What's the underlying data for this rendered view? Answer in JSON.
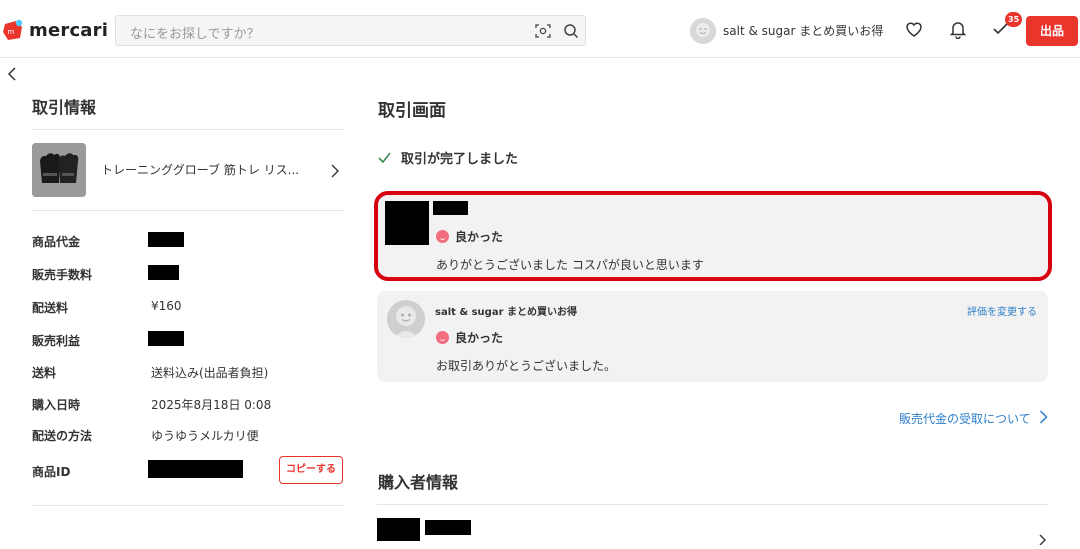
{
  "header": {
    "logo_text": "mercari",
    "search_placeholder": "なにをお探しですか？",
    "user_name": "salt & sugar まとめ買いお得",
    "todo_badge": "35",
    "sell_label": "出品",
    "colors": {
      "brand": "#ea352d",
      "link": "#2f7fc9"
    },
    "icons": [
      "camera-scan-icon",
      "search-icon",
      "heart-icon",
      "bell-icon",
      "checklist-icon"
    ]
  },
  "left": {
    "title": "取引情報",
    "product_name": "トレーニンググローブ 筋トレ リス...",
    "rows": [
      {
        "label": "商品代金",
        "value": ""
      },
      {
        "label": "販売手数料",
        "value": ""
      },
      {
        "label": "配送料",
        "value": "¥160"
      },
      {
        "label": "販売利益",
        "value": ""
      },
      {
        "label": "送料",
        "value": "送料込み(出品者負担)"
      },
      {
        "label": "購入日時",
        "value": "2025年8月18日 0:08"
      },
      {
        "label": "配送の方法",
        "value": "ゆうゆうメルカリ便"
      },
      {
        "label": "商品ID",
        "value": ""
      }
    ],
    "copy_label": "コピーする"
  },
  "right": {
    "title": "取引画面",
    "complete_text": "取引が完了しました",
    "buyer_review": {
      "rating": "良かった",
      "comment": "ありがとうございました コスパが良いと思います"
    },
    "seller_review": {
      "name": "salt & sugar まとめ買いお得",
      "change_label": "評価を変更する",
      "rating": "良かった",
      "comment": "お取引ありがとうございました。"
    },
    "payout_link": "販売代金の受取について",
    "buyer_info_title": "購入者情報"
  }
}
